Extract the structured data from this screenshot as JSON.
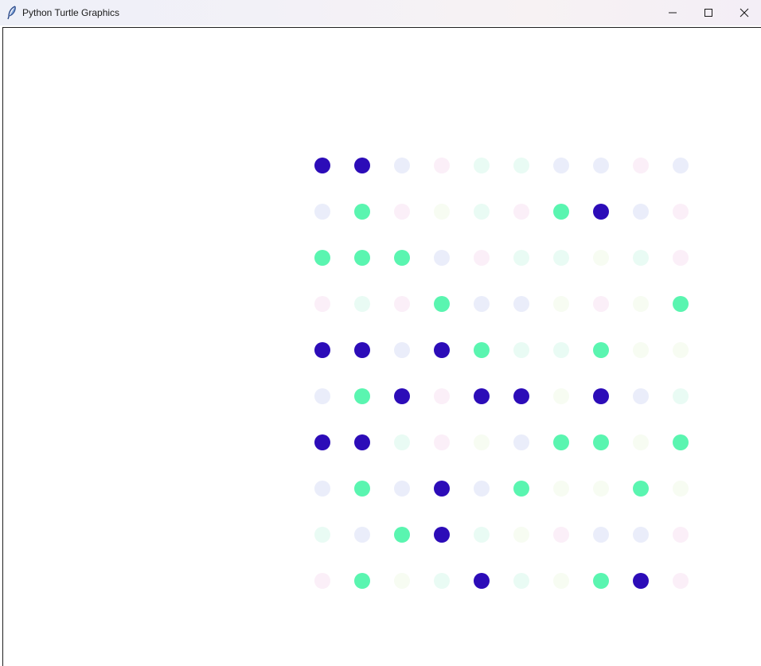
{
  "window": {
    "title": "Python Turtle Graphics",
    "icon": "feather-icon",
    "controls": [
      "minimize-icon",
      "maximize-icon",
      "close-icon"
    ]
  },
  "canvas": {
    "background": "#ffffff",
    "palette": {
      "D": "#2c0cb8",
      "G": "#5af5b0",
      "L": "#eaedfa",
      "P": "#fbeff8",
      "M": "#e9fbf4",
      "Y": "#f7fcf2"
    },
    "dot_grid": [
      [
        "D",
        "D",
        "L",
        "P",
        "M",
        "M",
        "L",
        "L",
        "P",
        "L"
      ],
      [
        "L",
        "G",
        "P",
        "Y",
        "M",
        "P",
        "G",
        "D",
        "L",
        "P"
      ],
      [
        "G",
        "G",
        "G",
        "L",
        "P",
        "M",
        "M",
        "Y",
        "M",
        "P"
      ],
      [
        "P",
        "M",
        "P",
        "G",
        "L",
        "L",
        "Y",
        "P",
        "Y",
        "G"
      ],
      [
        "D",
        "D",
        "L",
        "D",
        "G",
        "M",
        "M",
        "G",
        "Y",
        "Y"
      ],
      [
        "L",
        "G",
        "D",
        "P",
        "D",
        "D",
        "Y",
        "D",
        "L",
        "M"
      ],
      [
        "D",
        "D",
        "M",
        "P",
        "Y",
        "L",
        "G",
        "G",
        "Y",
        "G"
      ],
      [
        "L",
        "G",
        "L",
        "D",
        "L",
        "G",
        "Y",
        "Y",
        "G",
        "Y"
      ],
      [
        "M",
        "L",
        "G",
        "D",
        "M",
        "Y",
        "P",
        "L",
        "L",
        "P"
      ],
      [
        "P",
        "G",
        "Y",
        "M",
        "D",
        "M",
        "Y",
        "G",
        "D",
        "P"
      ]
    ]
  }
}
